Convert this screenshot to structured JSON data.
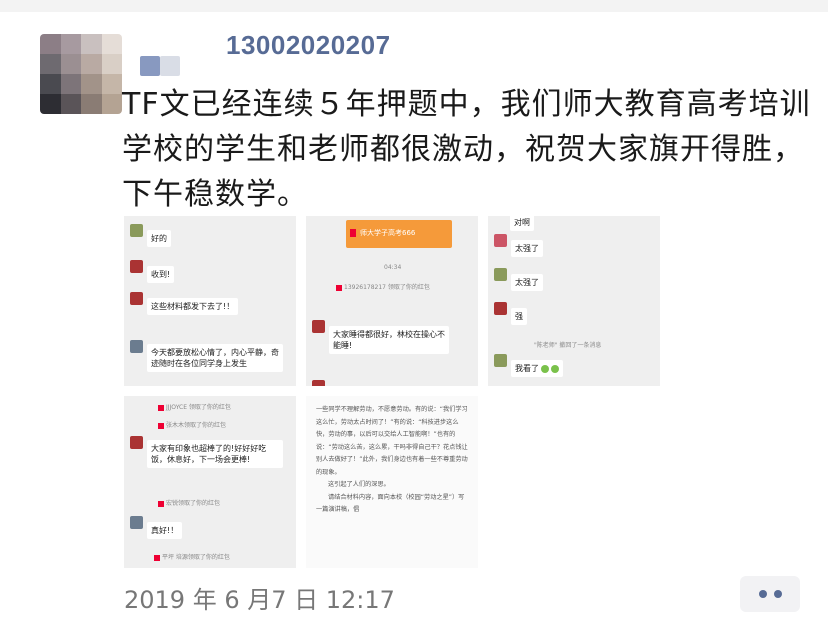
{
  "post": {
    "author": "13002020207",
    "text": "TF文已经连续５年押题中，我们师大教育高考培训学校的学生和老师都很激动，祝贺大家旗开得胜，下午稳数学。",
    "timestamp": "2019 年 6 月7 日 12:17"
  },
  "thumb1": {
    "msg1": "好的",
    "msg2": "收到!",
    "msg3": "这些材料都发下去了!！",
    "msg4": "今天都要放松心情了，内心平静，奇迹随时在各位同学身上发生"
  },
  "thumb2": {
    "card_title": "师大学子高考666",
    "time": "04:34",
    "sys1": "13926178217 领取了你的红包",
    "msg1": "大家睡得都很好，林校在操心不能睡!"
  },
  "thumb3": {
    "msg0": "对啊",
    "msg1": "太强了",
    "msg2": "太强了",
    "msg3": "强",
    "sys1": "\"陈老师\" 撤回了一条消息",
    "msg4": "我看了"
  },
  "thumb4": {
    "sys1": "JJJOYCE 领取了你的红包",
    "sys2": "张木木领取了你的红包",
    "msg1": "大家有印象也超棒了的!好好好吃饭，休息好，下一场会更棒!",
    "sys3": "宏锐领取了你的红包",
    "msg2": "真好!！",
    "sys4": "平坪 培源领取了你的红包"
  },
  "thumb5": {
    "lines": [
      "一些同学不理解劳动，不愿意劳动。有的说：“我们学习这么忙，劳动太占时间了！”有的说：“科技进步这么快，劳动的事，以后可以交给人工智能啊！”也有的说：“劳动这么苦，这么累，干吗非得自己干？花点钱让别人去做好了！”此外，我们身边也有着一些不尊重劳动的现象。",
      "这引起了人们的深思。",
      "请结合材料内容，面向本校（校园“劳动之星”）写一篇演讲稿，倡"
    ]
  },
  "colors": {
    "name": "#576b95",
    "red": "#e03",
    "orange": "#f59a3a"
  }
}
